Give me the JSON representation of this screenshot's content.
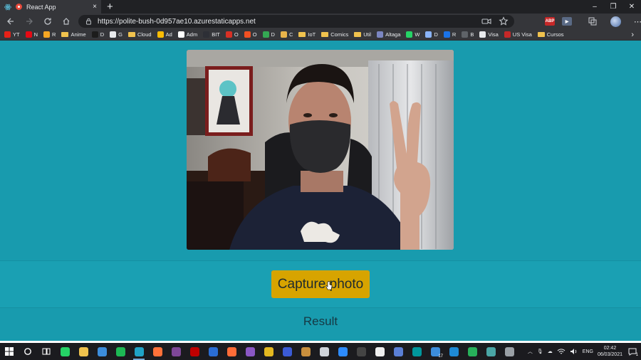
{
  "browser": {
    "tab": {
      "title": "React App",
      "close_glyph": "×"
    },
    "new_tab_glyph": "+",
    "window_controls": {
      "minimize": "–",
      "restore": "❐",
      "close": "✕"
    },
    "url": "https://polite-bush-0d957ae10.azurestaticapps.net",
    "extensions": [
      {
        "label": "ABP",
        "color": "#c62828"
      },
      {
        "label": "",
        "color": "#5a6a85"
      }
    ]
  },
  "bookmarks": [
    {
      "label": "YT",
      "kind": "icon",
      "color": "#e62117"
    },
    {
      "label": "N",
      "kind": "icon",
      "color": "#e50914"
    },
    {
      "label": "R",
      "kind": "icon",
      "color": "#f5a623"
    },
    {
      "label": "Anime",
      "kind": "folder"
    },
    {
      "label": "D",
      "kind": "icon",
      "color": "#1c1c1c"
    },
    {
      "label": "G",
      "kind": "icon",
      "color": "#e8eaed"
    },
    {
      "label": "Cloud",
      "kind": "folder"
    },
    {
      "label": "Ad",
      "kind": "icon",
      "color": "#fbbc04"
    },
    {
      "label": "Adm",
      "kind": "icon",
      "color": "#ffffff"
    },
    {
      "label": "BIT",
      "kind": "icon",
      "color": "#2d2f36"
    },
    {
      "label": "O",
      "kind": "icon",
      "color": "#d93025"
    },
    {
      "label": "O",
      "kind": "icon",
      "color": "#f25022"
    },
    {
      "label": "D",
      "kind": "icon",
      "color": "#34a853"
    },
    {
      "label": "C",
      "kind": "icon",
      "color": "#e8b34a"
    },
    {
      "label": "IoT",
      "kind": "folder"
    },
    {
      "label": "Comics",
      "kind": "folder"
    },
    {
      "label": "Util",
      "kind": "folder"
    },
    {
      "label": "Altaga",
      "kind": "icon",
      "color": "#7b86c2"
    },
    {
      "label": "W",
      "kind": "icon",
      "color": "#25d366"
    },
    {
      "label": "D",
      "kind": "icon",
      "color": "#8ab4f8"
    },
    {
      "label": "R",
      "kind": "icon",
      "color": "#1a73e8"
    },
    {
      "label": "B",
      "kind": "icon",
      "color": "#5f6368"
    },
    {
      "label": "Visa",
      "kind": "icon",
      "color": "#e8eaed"
    },
    {
      "label": "US Visa",
      "kind": "icon",
      "color": "#c62828"
    },
    {
      "label": "Cursos",
      "kind": "folder"
    }
  ],
  "page": {
    "capture_button": "Capture photo",
    "result_label": "Result"
  },
  "taskbar": {
    "apps": [
      {
        "name": "whatsapp",
        "color": "#25d366"
      },
      {
        "name": "file-explorer",
        "color": "#f0c24e"
      },
      {
        "name": "mail",
        "color": "#3c8ddc"
      },
      {
        "name": "spotify",
        "color": "#1db954"
      },
      {
        "name": "edge",
        "color": "#1fa3c7",
        "active": true
      },
      {
        "name": "firefox",
        "color": "#ff7139"
      },
      {
        "name": "tor",
        "color": "#7e4798"
      },
      {
        "name": "filezilla",
        "color": "#bf0000"
      },
      {
        "name": "teamviewer",
        "color": "#2a6dd4"
      },
      {
        "name": "postman",
        "color": "#ff6c37"
      },
      {
        "name": "github-desktop",
        "color": "#8a57c4"
      },
      {
        "name": "app-yellow",
        "color": "#e3b820"
      },
      {
        "name": "app-blue",
        "color": "#3b5bd6"
      },
      {
        "name": "davinci",
        "color": "#c98f3d"
      },
      {
        "name": "obs",
        "color": "#cfd4da"
      },
      {
        "name": "zoom",
        "color": "#2d8cff"
      },
      {
        "name": "app-dark",
        "color": "#444"
      },
      {
        "name": "inkscape",
        "color": "#eeeeee"
      },
      {
        "name": "app-network",
        "color": "#5a7fd6"
      },
      {
        "name": "arduino",
        "color": "#00979d"
      },
      {
        "name": "calendar",
        "color": "#3c8ddc"
      },
      {
        "name": "vscode",
        "color": "#1e8ad6"
      },
      {
        "name": "app-green",
        "color": "#27b05a"
      },
      {
        "name": "app-teal",
        "color": "#4aa6a6"
      },
      {
        "name": "camera",
        "color": "#9aa0a6"
      }
    ],
    "calendar_badge": "17",
    "language": "ENG",
    "time": "02:42",
    "date": "06/03/2021",
    "notification_count": "1"
  }
}
